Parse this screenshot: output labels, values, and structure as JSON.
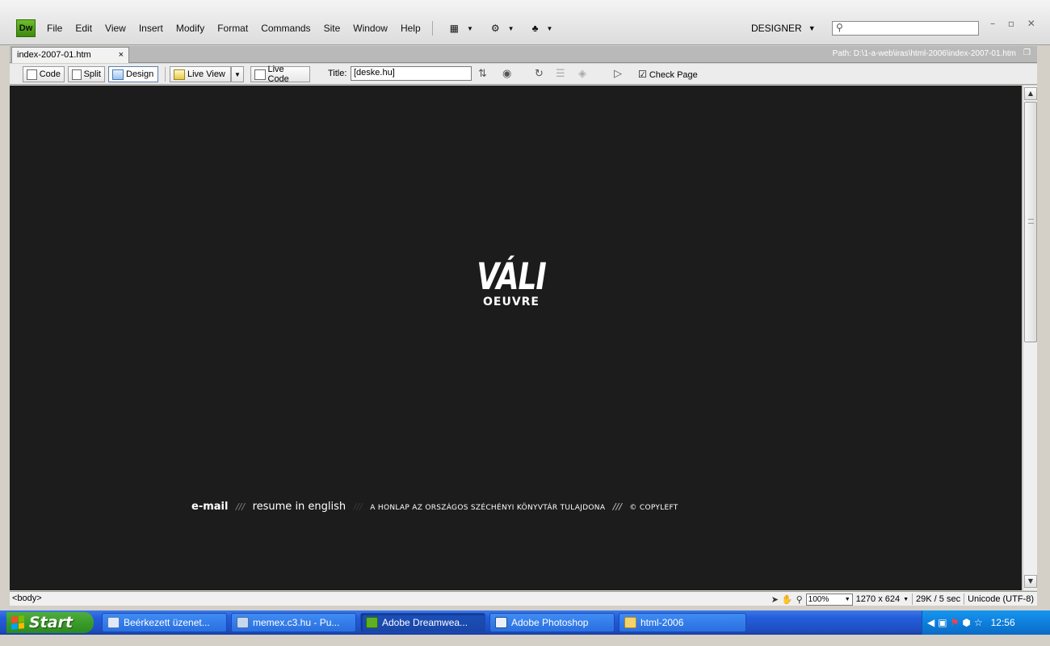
{
  "app": {
    "logo": "Dw",
    "menu": [
      "File",
      "Edit",
      "View",
      "Insert",
      "Modify",
      "Format",
      "Commands",
      "Site",
      "Window",
      "Help"
    ],
    "workspace": "DESIGNER",
    "window_controls": "– ▫ ✕"
  },
  "document": {
    "tab_name": "index-2007-01.htm",
    "tab_close": "×",
    "path": "Path:  D:\\1-a-web\\iras\\html-2006\\index-2007-01.htm"
  },
  "doc_toolbar": {
    "code": "Code",
    "split": "Split",
    "design": "Design",
    "live_view": "Live View",
    "live_code": "Live Code",
    "title_label": "Title:",
    "title_value": "[deske.hu]",
    "check_page": "Check Page"
  },
  "page": {
    "logo_top": "VÁLI",
    "logo_bottom": "OEUVRE",
    "footer": {
      "email": "e-mail",
      "sep": "///",
      "resume": "resume in english",
      "owner": "A HONLAP AZ ORSZÁGOS SZÉCHÉNYI KÖNYVTÁR TULAJDONA",
      "copyleft": "© COPYLEFT"
    }
  },
  "status": {
    "tag": "<body>",
    "zoom": "100%",
    "dimensions": "1270 x 624",
    "size": "29K / 5 sec",
    "encoding": "Unicode (UTF-8)"
  },
  "taskbar": {
    "start": "Start",
    "tasks": [
      "Beérkezett üzenet...",
      "memex.c3.hu - Pu...",
      "Adobe Dreamwea...",
      "Adobe Photoshop",
      "html-2006"
    ],
    "clock": "12:56"
  },
  "colors": {
    "canvas": "#1c1c1c",
    "taskbar": "#245ddb",
    "start_button": "#3a9c2a"
  }
}
